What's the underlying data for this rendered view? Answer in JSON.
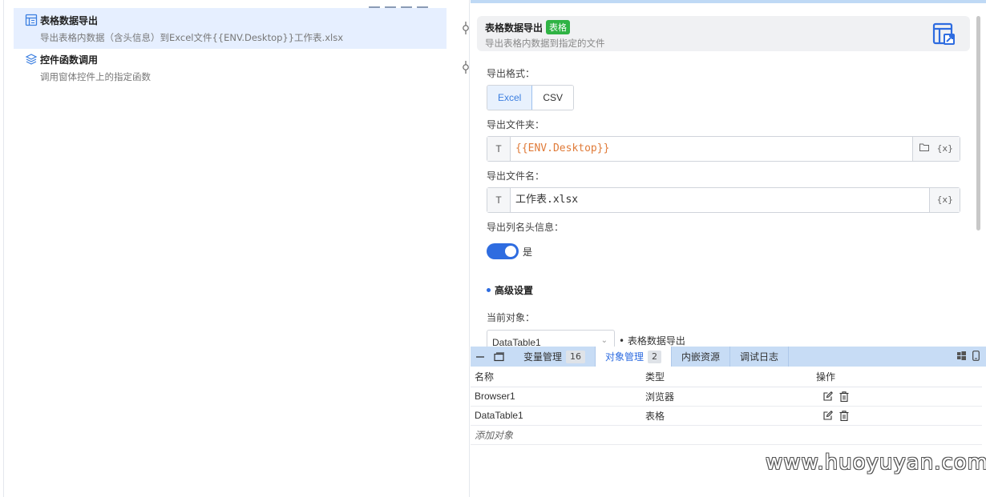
{
  "steps": [
    {
      "title": "表格数据导出",
      "desc": "导出表格内数据（含头信息）到Excel文件{{ENV.Desktop}}工作表.xlsx",
      "icon": "table-export-icon",
      "active": true
    },
    {
      "title": "控件函数调用",
      "desc": "调用窗体控件上的指定函数",
      "icon": "layers-icon",
      "active": false
    }
  ],
  "header": {
    "title": "表格数据导出",
    "tag": "表格",
    "desc": "导出表格内数据到指定的文件",
    "icon": "table-export-icon"
  },
  "form": {
    "format_label": "导出格式：",
    "format_options": [
      "Excel",
      "CSV"
    ],
    "format_selected": "Excel",
    "folder_label": "导出文件夹：",
    "folder_prefix": "T",
    "folder_value": "{{ENV.Desktop}}",
    "folder_var_btn": "{x}",
    "filename_label": "导出文件名：",
    "filename_prefix": "T",
    "filename_value": "工作表.xlsx",
    "filename_var_btn": "{x}",
    "header_label": "导出列名头信息：",
    "header_toggle": true,
    "header_toggle_text": "是",
    "advanced_label": "高级设置",
    "object_label": "当前对象：",
    "object_value": "DataTable1",
    "object_note": "• 表格数据导出"
  },
  "bottom": {
    "tabs": [
      {
        "label": "变量管理",
        "count": "16",
        "selected": false
      },
      {
        "label": "对象管理",
        "count": "2",
        "selected": true
      },
      {
        "label": "内嵌资源",
        "count": null,
        "selected": false
      },
      {
        "label": "调试日志",
        "count": null,
        "selected": false
      }
    ],
    "columns": [
      "名称",
      "类型",
      "操作"
    ],
    "rows": [
      {
        "name": "Browser1",
        "type": "浏览器"
      },
      {
        "name": "DataTable1",
        "type": "表格"
      }
    ],
    "add_label": "添加对象"
  },
  "watermark": "www.huoyuyan.com",
  "colors": {
    "accent": "#2e6ce0",
    "tag_green": "#2fb344",
    "tab_bar": "#c7dcf5",
    "active_step": "#e6efff",
    "variable_text": "#e07b39"
  }
}
